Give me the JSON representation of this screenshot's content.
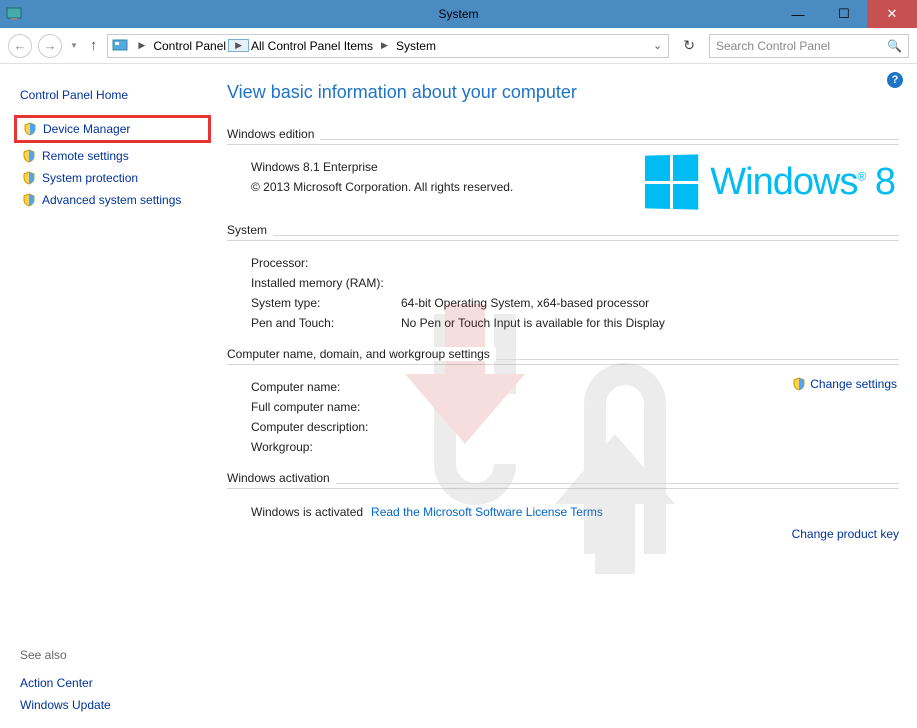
{
  "titlebar": {
    "title": "System"
  },
  "breadcrumb": {
    "items": [
      "Control Panel",
      "All Control Panel Items",
      "System"
    ]
  },
  "search": {
    "placeholder": "Search Control Panel"
  },
  "sidebar": {
    "heading": "Control Panel Home",
    "links": [
      {
        "label": "Device Manager"
      },
      {
        "label": "Remote settings"
      },
      {
        "label": "System protection"
      },
      {
        "label": "Advanced system settings"
      }
    ],
    "see_also_heading": "See also",
    "see_also": [
      "Action Center",
      "Windows Update"
    ]
  },
  "content": {
    "title": "View basic information about your computer",
    "edition": {
      "legend": "Windows edition",
      "product": "Windows 8.1 Enterprise",
      "copyright": "© 2013 Microsoft Corporation. All rights reserved.",
      "brand": "Windows",
      "brand_ver": "8"
    },
    "system": {
      "legend": "System",
      "rows": {
        "processor_l": "Processor:",
        "processor_v": "",
        "ram_l": "Installed memory (RAM):",
        "ram_v": "",
        "type_l": "System type:",
        "type_v": "64-bit Operating System, x64-based processor",
        "pen_l": "Pen and Touch:",
        "pen_v": "No Pen or Touch Input is available for this Display"
      }
    },
    "computer": {
      "legend": "Computer name, domain, and workgroup settings",
      "change": "Change settings",
      "rows": {
        "name_l": "Computer name:",
        "name_v": "",
        "full_l": "Full computer name:",
        "full_v": "",
        "desc_l": "Computer description:",
        "desc_v": "",
        "wg_l": "Workgroup:",
        "wg_v": ""
      }
    },
    "activation": {
      "legend": "Windows activation",
      "status": "Windows is activated",
      "license_link": "Read the Microsoft Software License Terms",
      "product_key": "Change product key"
    }
  }
}
